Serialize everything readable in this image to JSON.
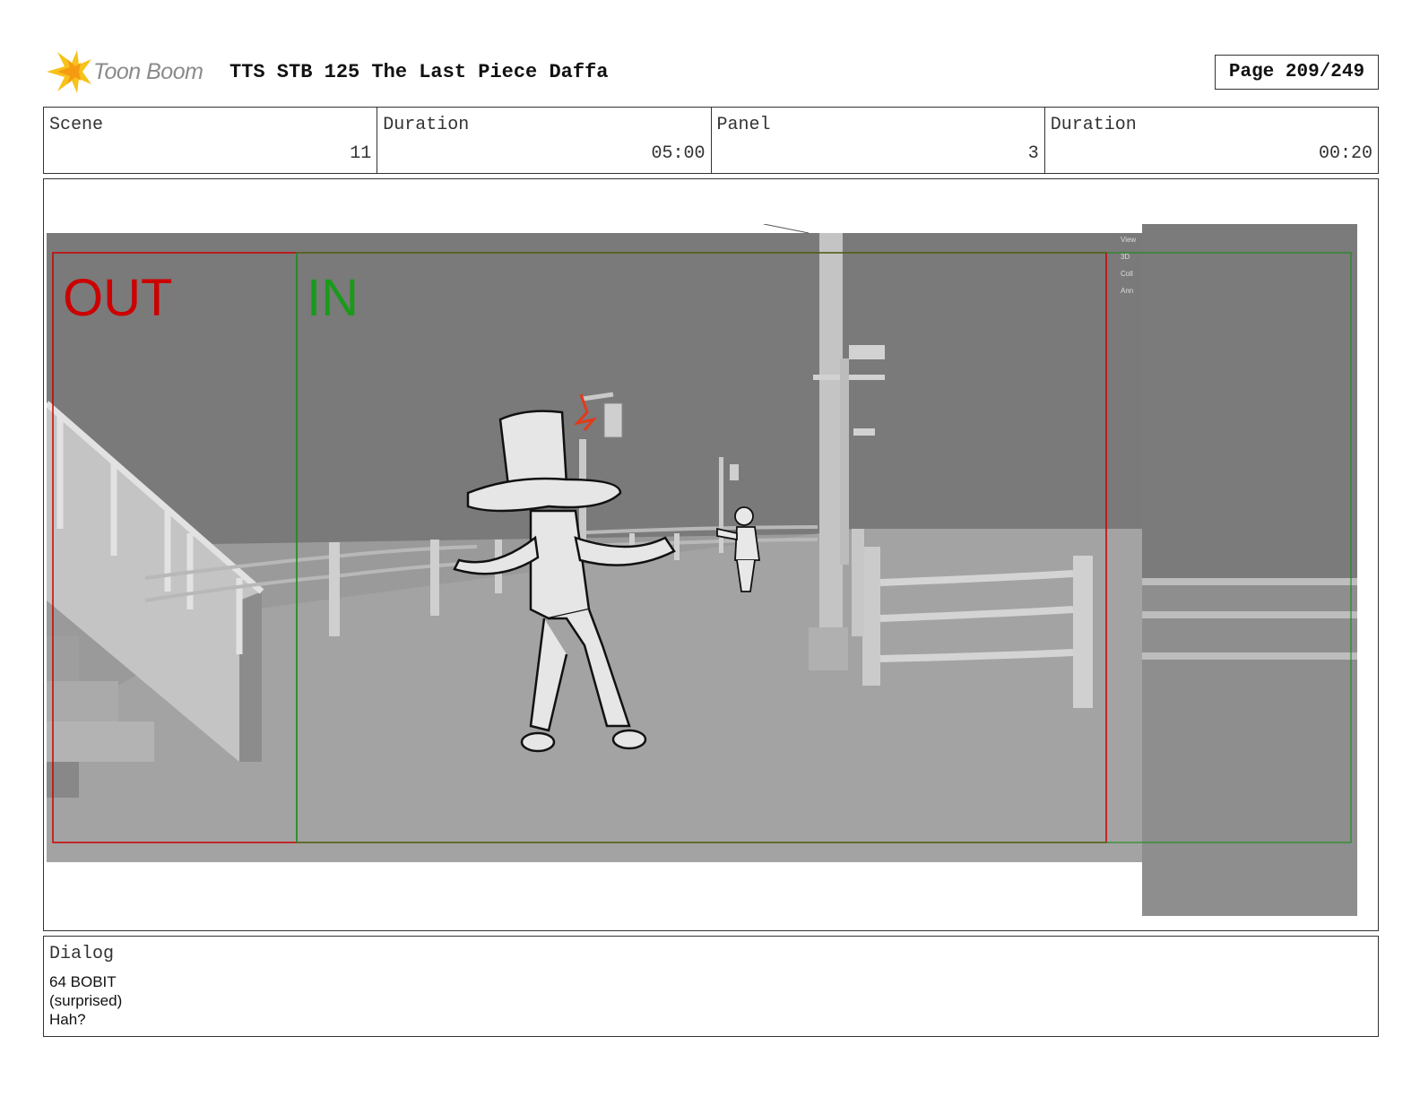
{
  "header": {
    "logo_text": "Toon Boom",
    "title": "TTS STB 125 The Last Piece Daffa",
    "page": "Page 209/249"
  },
  "info": {
    "scene_label": "Scene",
    "scene_value": "11",
    "scene_duration_label": "Duration",
    "scene_duration_value": "05:00",
    "panel_label": "Panel",
    "panel_value": "3",
    "panel_duration_label": "Duration",
    "panel_duration_value": "00:20"
  },
  "frame": {
    "out_label": "OUT",
    "in_label": "IN",
    "out_color": "#cc0000",
    "in_color": "#1a9a1a",
    "viewport_menu": [
      "View",
      "3D",
      "Coll",
      "Ann"
    ]
  },
  "dialog": {
    "label": "Dialog",
    "lines": [
      "64 BOBIT",
      "(surprised)",
      "Hah?"
    ]
  }
}
